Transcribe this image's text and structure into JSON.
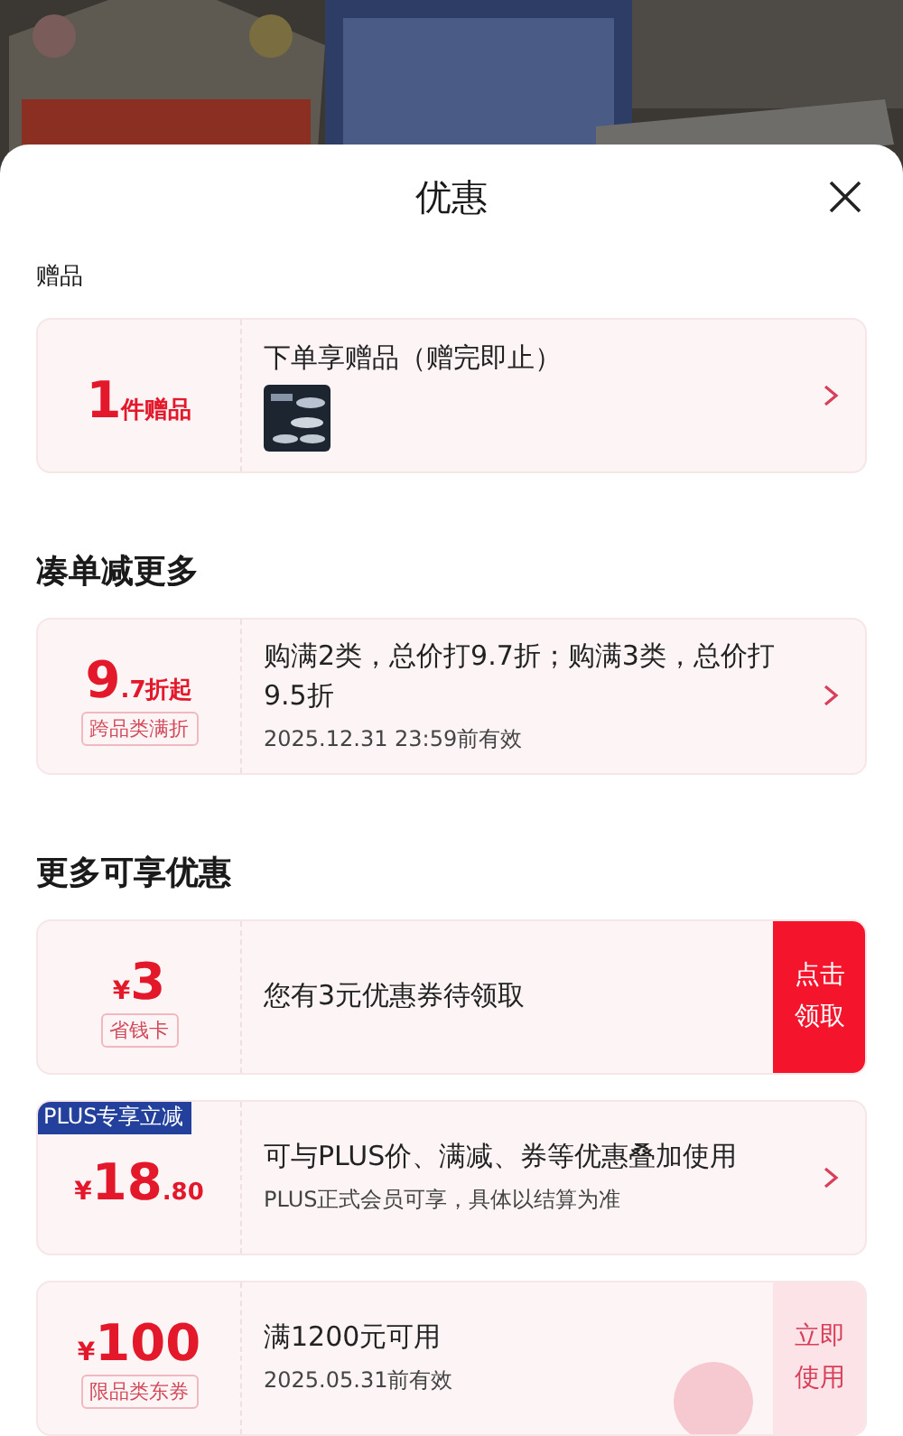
{
  "sheet": {
    "title": "优惠"
  },
  "sections": [
    {
      "heading": "赠品",
      "kind": "minor",
      "coupons": [
        {
          "amount": {
            "main": "1",
            "minor": "件赠品"
          },
          "title": "下单享赠品（赠完即止）",
          "has_thumbnail": true,
          "action": {
            "kind": "arrow"
          }
        }
      ]
    },
    {
      "heading": "凑单减更多",
      "kind": "major",
      "coupons": [
        {
          "amount": {
            "main": "9",
            "minor": ".7折起"
          },
          "tag": "跨品类满折",
          "title": "购满2类，总价打9.7折；购满3类，总价打9.5折",
          "subtitle": "2025.12.31  23:59前有效",
          "action": {
            "kind": "arrow"
          }
        }
      ]
    },
    {
      "heading": "更多可享优惠",
      "kind": "major",
      "coupons": [
        {
          "amount": {
            "currency": "¥",
            "main": "3"
          },
          "tag": "省钱卡",
          "title": "您有3元优惠券待领取",
          "action": {
            "kind": "claim",
            "label": "点击领取"
          }
        },
        {
          "badge": "PLUS专享立减",
          "amount": {
            "currency": "¥",
            "main": "18",
            "minor": ".80"
          },
          "title": "可与PLUS价、满减、券等优惠叠加使用",
          "subtitle": "PLUS正式会员可享，具体以结算为准",
          "action": {
            "kind": "arrow"
          }
        },
        {
          "amount": {
            "currency": "¥",
            "main": "100"
          },
          "tag": "限品类东券",
          "title": "满1200元可用",
          "subtitle": "2025.05.31前有效",
          "stamped": true,
          "action": {
            "kind": "use",
            "label": "立即使用"
          }
        }
      ]
    }
  ]
}
